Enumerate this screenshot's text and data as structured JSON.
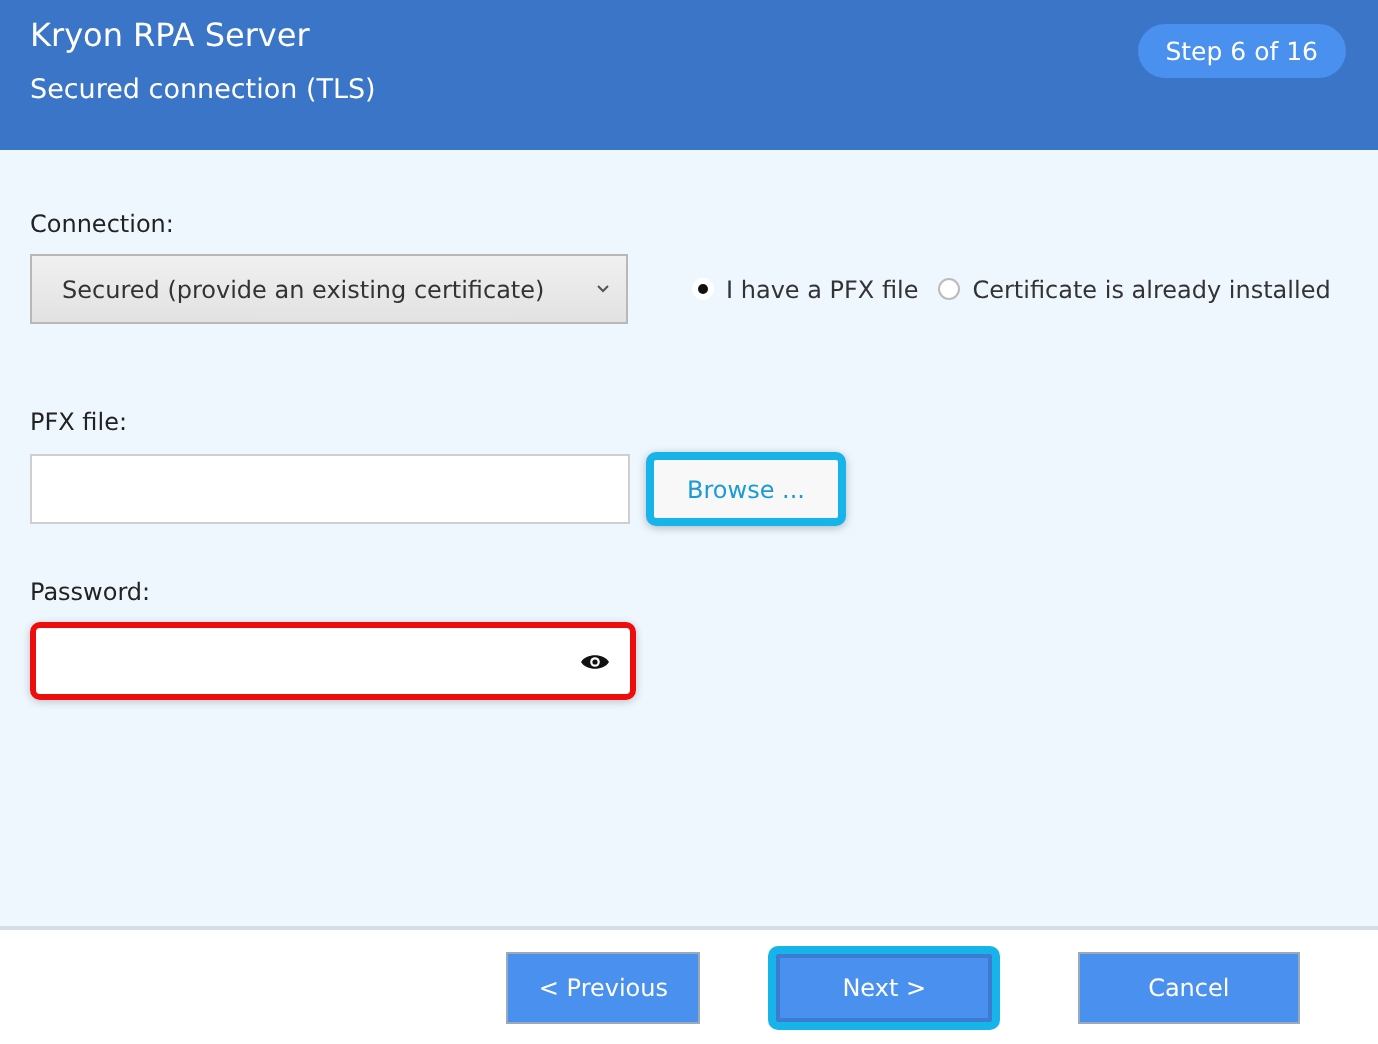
{
  "header": {
    "title": "Kryon RPA Server",
    "subtitle": "Secured connection (TLS)",
    "step": "Step 6 of 16"
  },
  "connection": {
    "label": "Connection:",
    "value": "Secured (provide an existing certificate)"
  },
  "options": [
    {
      "label": "I have a PFX file",
      "selected": true
    },
    {
      "label": "Certificate is already installed",
      "selected": false
    }
  ],
  "pfx": {
    "label": "PFX file:",
    "browse": {
      "label": "Browse ...",
      "highlighted": true
    }
  },
  "password": {
    "label": "Password:",
    "error": true
  },
  "buttons": [
    {
      "label": "< Previous",
      "highlighted": false
    },
    {
      "label": "Next >",
      "highlighted": true
    },
    {
      "label": "Cancel",
      "highlighted": false
    }
  ]
}
